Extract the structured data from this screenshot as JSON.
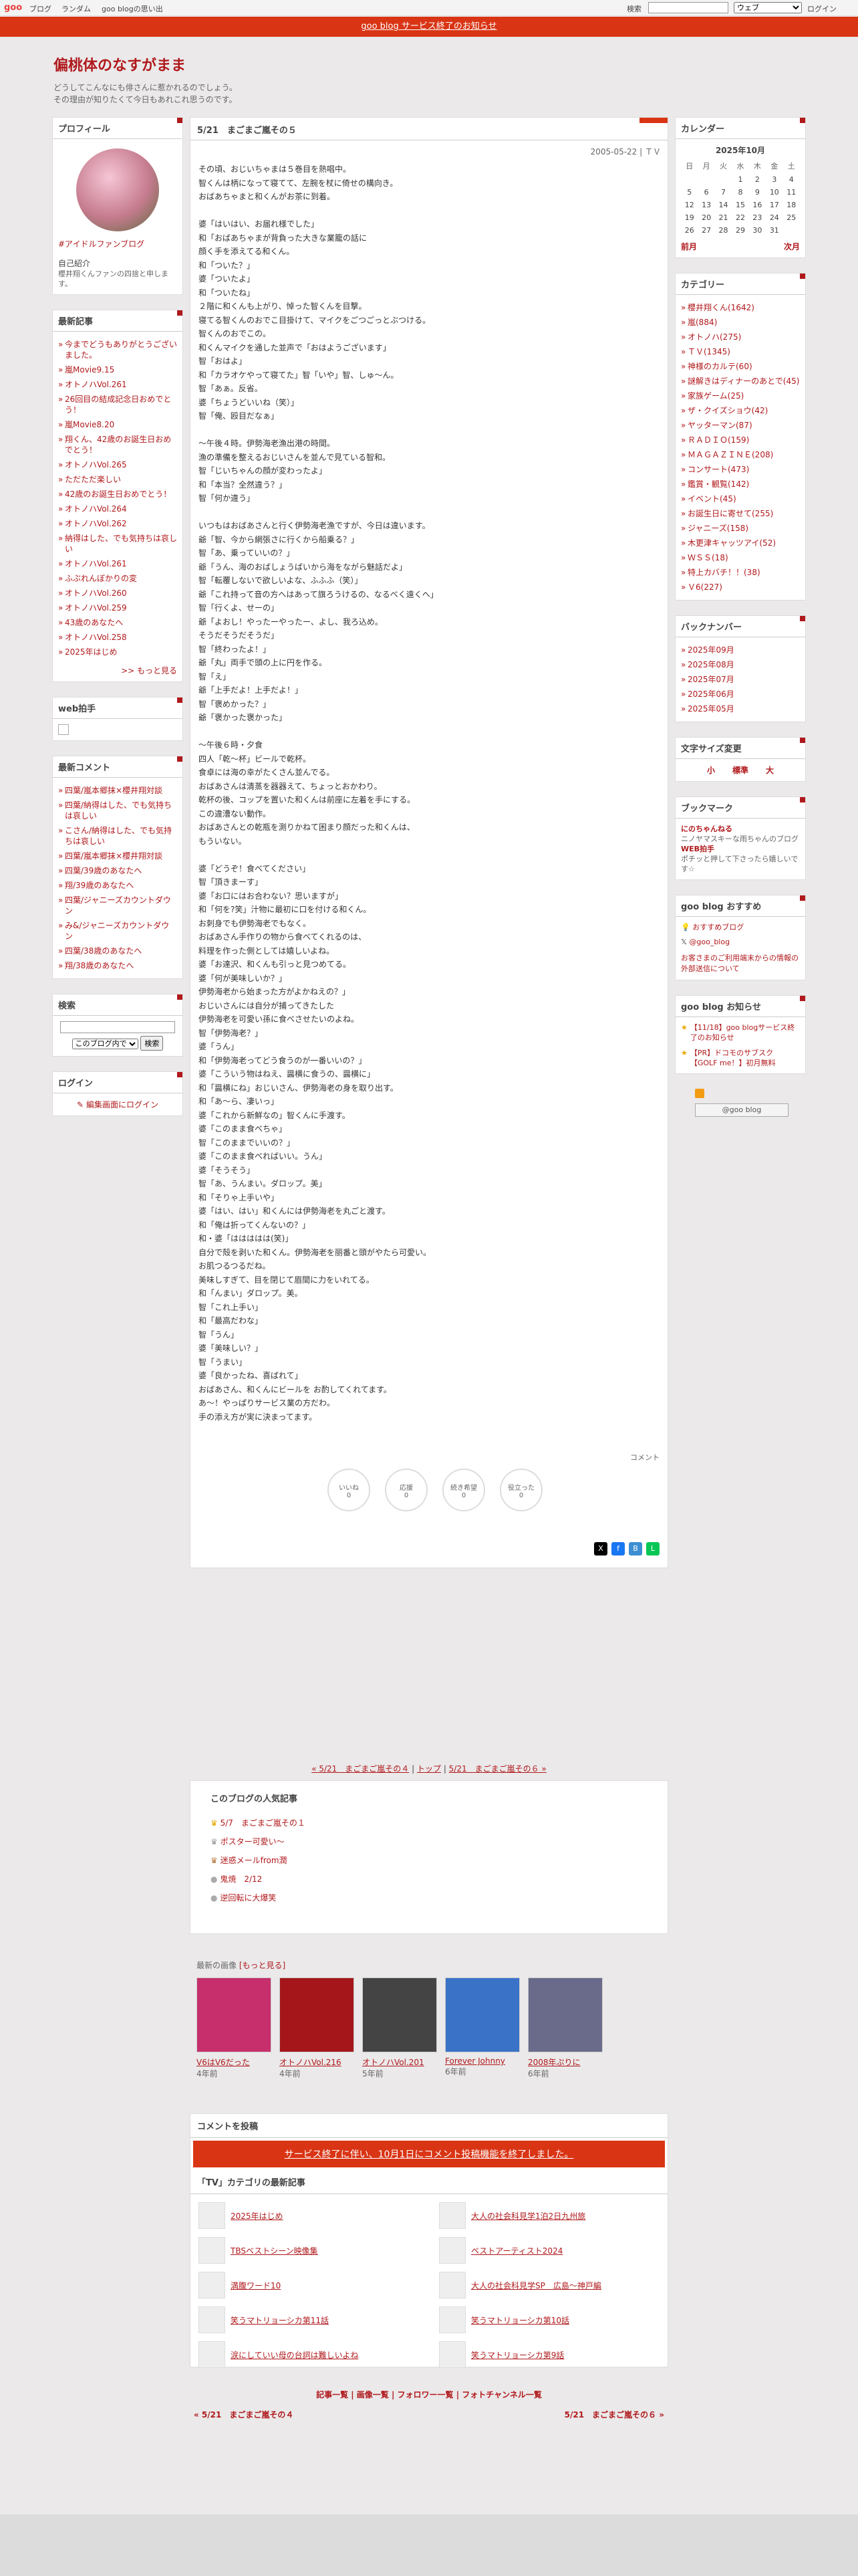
{
  "topbar": {
    "logo": "goo",
    "links": [
      "ブログ",
      "ランダム",
      "goo blogの思い出"
    ],
    "search_label": "検索",
    "search_value": "",
    "select": "ウェブ",
    "login": "ログイン"
  },
  "notice": {
    "text": "goo blog サービス終了のお知らせ"
  },
  "blog": {
    "title": "偏桃体のなすがまま",
    "desc1": "どうしてこんなにも俳さんに惹かれるのでしょう。",
    "desc2": "その理由が知りたくて今日もあれこれ思うのです。"
  },
  "left": {
    "profile": {
      "title": "プロフィール",
      "hashtag": "#アイドルファンブログ",
      "intro_label": "自己紹介",
      "intro": "櫻井翔くんファンの四捨と申します。"
    },
    "recent": {
      "title": "最新記事",
      "items": [
        "今までどうもありがとうございました。",
        "嵐Movie9.15",
        "オトノハVol.261",
        "26回目の結成記念日おめでとう！",
        "嵐Movie8.20",
        "翔くん、42歳のお誕生日おめでとう！",
        "オトノハVol.265",
        "ただただ楽しい",
        "42歳のお誕生日おめでとう！",
        "オトノハVol.264",
        "オトノハVol.262",
        "納得はした、でも気持ちは哀しい",
        "オトノハVol.261",
        "ふぶれんぼかりの変",
        "オトノハVol.260",
        "オトノハVol.259",
        "43歳のあなたへ",
        "オトノハVol.258",
        "2025年はじめ"
      ],
      "more": ">> もっと見る"
    },
    "clap": {
      "title": "web拍手"
    },
    "comments": {
      "title": "最新コメント",
      "items": [
        "四葉/嵐本郷抹×櫻井翔対談",
        "四葉/納得はした、でも気持ちは哀しい",
        "こさん/納得はした、でも気持ちは哀しい",
        "四葉/嵐本郷抹×櫻井翔対談",
        "四葉/39歳のあなたへ",
        "翔/39歳のあなたへ",
        "四葉/ジャニーズカウントダウン",
        "み&/ジャニーズカウントダウン",
        "四葉/38歳のあなたへ",
        "翔/38歳のあなたへ"
      ]
    },
    "search": {
      "title": "検索",
      "option": "このブログ内で",
      "button": "検索"
    },
    "login": {
      "title": "ログイン",
      "link": "編集画面にログイン"
    }
  },
  "article": {
    "title": "5/21　まごまご嵐その５",
    "date": "2005-05-22 | ＴＶ",
    "body": "その頃、おじいちゃまは５巻目を熱唱中。\n智くんは柄になって寝てて、左腕を杖に倚せの構向き。\nおばあちゃまと和くんがお茶に到着。\n\n婆「はいはい、お届れ様でした」\n和「おばあちゃまが背負った大きな業籠の話に\n顔く手を添えてる和くん。\n和「ついた？」\n婆「ついたよ」\n和「ついたね」\n２階に和くんも上がり、悼った智くんを目撃。\n寝てる智くんのおでこ目掛けて、マイクをごつごっとぶつける。\n智くんのおでこの。\n和くんマイクを通した並声で「おはようございます」\n智「おはよ」\n和「カラオケやって寝てた」智「いや」智、しゅ～ん。\n智「あぁ。反省。\n婆「ちょうどいいね（笑）」\n智「俺、殴目だなぁ」\n\n～午後４時。伊勢海老漁出港の時間。\n漁の準備を整えるおじいさんを並んで見ている智和。\n智「じいちゃんの顔が変わったよ」\n和「本当？全然違う？」\n智「何か違う」\n\nいつもはおばあさんと行く伊勢海老漁ですが、今日は違います。\n爺「智、今から網張さに行くから船乗る？」\n智「あ、乗っていいの？」\n爺「うん、海のおばしょうばいから海をながら魅話だよ」\n智「転覆しないで欲しいよな、ふふふ（笑）」\n爺「これ持って音の方へはあって旗ろうけるの、なるべく遠くへ」\n智「行くよ、せーの」\n爺「よおし！やったーやったー、よし、我ろ込め。\nそうだそうだそうだ」\n智「終わったよ！」\n爺「丸」両手で頭の上に円を作る。\n智「え」\n爺「上手だよ！上手だよ！」\n智「褒めかった？」\n爺「褒かった褒かった」\n\n～午後６時・夕食\n四人「乾～杯」ビールで乾杯。\n食卓には海の幸がたくさん並んでる。\nおばあさんは清蒸を器器えて、ちょっとおかわり。\n乾杯の後、コップを置いた和くんは前座に左着を手にする。\nこの違漕ない動作。\nおばあさんとの乾瓶を測りかねて困まり顔だった和くんは、\nもういない。\n\n婆「どうぞ！食べてください」\n智「頂きまーす」\n婆「お口にはお合わない？思いますが」\n和「何を?笑」汁物に最初に口を付ける和くん。\nお刺身でも伊勢海老でもなく。\nおばあさん手作りの物から食べてくれるのは、\n料理を作った側としては嬉しいよね。\n婆「お達沢、和くんも引っと見つめてる。\n婆「何が美味しいか？」\n伊勢海老から始まった方がよかねえの？」\nおじいさんには自分が捕ってきたした\n伊勢海老を可愛い孫に食べさせたいのよね。\n智「伊勢海老？」\n婆「うん」\n和「伊勢海老ってどう食うのが一番いいの？」\n婆「こういう物はねえ、醤横に食うの、醤横に」\n和「醤横にね」おじいさん、伊勢海老の身を取り出す。\n和「あ～ら、凄いっ」\n婆「これから新鮮なの」智くんに手渡す。\n婆「このまま食べちゃ」\n智「このままでいいの？」\n婆「このまま食べればいい。うん」\n婆「そうそう」\n智「あ、うんまい。ダロップ。美」\n和「そりゃ上手いや」\n婆「はい、はい」和くんには伊勢海老を丸ごと渡す。\n和「俺は折ってくんないの？」\n和・婆「ははははは(笑)」\n自分で殻を剥いた和くん。伊勢海老を丽番と頭がやたら可愛い。\nお肌つるつるだね。\n美味しすぎて、目を閉じて眉間に力をいれてる。\n和「んまい」ダロップ。美。\n智「これ上手い」\n和「最高だわな」\n智「うん」\n婆「美味しい？」\n智「うまい」\n婆「良かったね、喜ばれて」\nおばあさん、和くんにビールを お酌してくれてます。\nあ～！やっぱりサービス業の方だわ。\n手の添え方が実に決まってます。",
    "comment_link": "コメント",
    "reactions": [
      {
        "label": "いいね",
        "count": "0"
      },
      {
        "label": "応援",
        "count": "0"
      },
      {
        "label": "続き希望",
        "count": "0"
      },
      {
        "label": "役立った",
        "count": "0"
      }
    ]
  },
  "right": {
    "calendar": {
      "title": "カレンダー",
      "month": "2025年10月",
      "dow": [
        "日",
        "月",
        "火",
        "水",
        "木",
        "金",
        "土"
      ],
      "rows": [
        [
          "",
          "",
          "",
          "1",
          "2",
          "3",
          "4"
        ],
        [
          "5",
          "6",
          "7",
          "8",
          "9",
          "10",
          "11"
        ],
        [
          "12",
          "13",
          "14",
          "15",
          "16",
          "17",
          "18"
        ],
        [
          "19",
          "20",
          "21",
          "22",
          "23",
          "24",
          "25"
        ],
        [
          "26",
          "27",
          "28",
          "29",
          "30",
          "31",
          ""
        ]
      ],
      "prev": "前月",
      "next": "次月"
    },
    "categories": {
      "title": "カテゴリー",
      "items": [
        "櫻井翔くん(1642)",
        "嵐(884)",
        "オトノハ(275)",
        "ＴＶ(1345)",
        "神様のカルテ(60)",
        "謎解きはディナーのあとで(45)",
        "家族ゲーム(25)",
        "ザ・クイズショウ(42)",
        "ヤッターマン(87)",
        "ＲＡＤＩＯ(159)",
        "ＭＡＧＡＺＩＮＥ(208)",
        "コンサート(473)",
        "鑑賞・観覧(142)",
        "イベント(45)",
        "お誕生日に寄せて(255)",
        "ジャニーズ(158)",
        "木更津キャッツアイ(52)",
        "ＷＳＳ(18)",
        "特上カバチ！！(38)",
        "Ｖ6(227)"
      ]
    },
    "backnumber": {
      "title": "バックナンバー",
      "items": [
        "2025年09月",
        "2025年08月",
        "2025年07月",
        "2025年06月",
        "2025年05月"
      ]
    },
    "fontsize": {
      "title": "文字サイズ変更",
      "small": "小",
      "normal": "標準",
      "large": "大"
    },
    "bookmark": {
      "title": "ブックマーク",
      "l1": "にのちゃんねる",
      "d1": "ニノヤマスキーな雨ちゃんのブログ",
      "l2": "WEB拍手",
      "d2": "ポチッと押して下さったら嬉しいです☆"
    },
    "goo_recommend": {
      "title": "goo blog おすすめ",
      "l1": "おすすめブログ",
      "l2": "@goo_blog",
      "l3": "お客さまのご利用端末からの情報の外部送信について"
    },
    "goo_notice": {
      "title": "goo blog お知らせ",
      "l1": "【11/18】goo blogサービス終了のお知らせ",
      "l2": "【PR】ドコモのサブスク【GOLF me！】初月無料"
    },
    "badge": "@goo blog"
  },
  "pager": {
    "prev": "« 5/21　まごまご嵐その４",
    "top": "トップ",
    "next": "5/21　まごまご嵐その６ »"
  },
  "popular": {
    "title": "このブログの人気記事",
    "items": [
      "5/7　まごまご嵐その１",
      "ポスター可愛い～",
      "迷惑メールfrom潤",
      "鬼焼　2/12",
      "逆回転に大爆笑"
    ]
  },
  "images": {
    "title": "最新の画像",
    "more": "[もっと見る]",
    "items": [
      {
        "cap": "V6はV6だった",
        "ago": "4年前",
        "color": "#c62f6b"
      },
      {
        "cap": "オトノハVol.216",
        "ago": "4年前",
        "color": "#a4161a"
      },
      {
        "cap": "オトノハVol.201",
        "ago": "5年前",
        "color": "#444444"
      },
      {
        "cap": "Forever Johnny",
        "ago": "6年前",
        "color": "#3a72c8"
      },
      {
        "cap": "2008年ぷりに",
        "ago": "6年前",
        "color": "#6a6a8a"
      }
    ]
  },
  "comment_post": {
    "title": "コメントを投稿",
    "notice": "サービス終了に伴い、10月1日にコメント投稿機能を終了しました。"
  },
  "tv_recent": {
    "title": "「TV」カテゴリの最新記事",
    "items": [
      "2025年はじめ",
      "大人の社会科見学1泊2日九州旅",
      "TBSベストシーン映像集",
      "ベストアーティスト2024",
      "満腹ワード10",
      "大人の社会科見学SP　広島～神戸編",
      "笑うマトリョーシカ第11話",
      "笑うマトリョーシカ第10話",
      "涙にしていい母の台詞は難しいよね",
      "笑うマトリョーシカ第9話"
    ]
  },
  "footer": {
    "links": "記事一覧 | 画像一覧 | フォロワー一覧 | フォトチャンネル一覧",
    "prev": "« 5/21　まごまご嵐その４",
    "next": "5/21　まごまご嵐その６ »"
  }
}
